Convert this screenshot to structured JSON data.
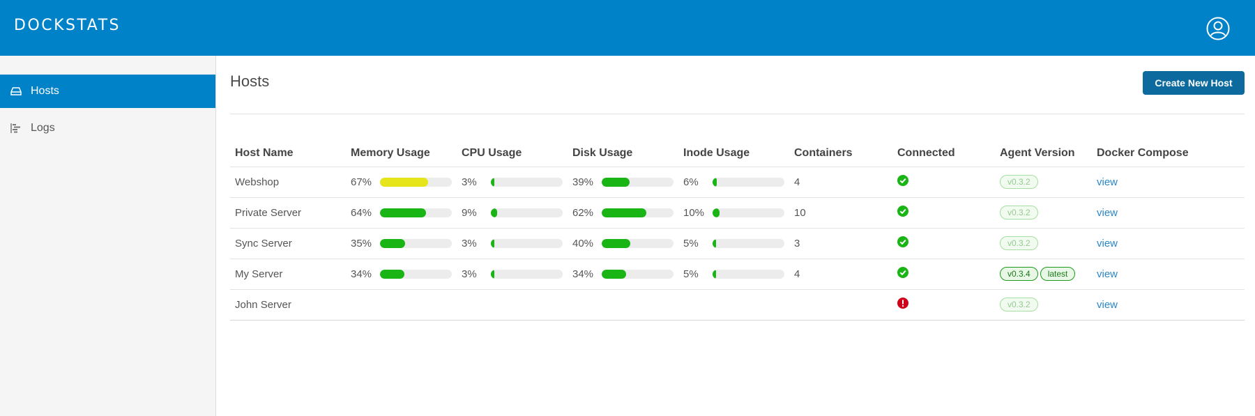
{
  "app": {
    "logo_text": "DOCKSTATS"
  },
  "sidebar": {
    "items": [
      {
        "label": "Hosts",
        "icon": "drive-icon",
        "active": true
      },
      {
        "label": "Logs",
        "icon": "logs-icon",
        "active": false
      }
    ]
  },
  "main": {
    "title": "Hosts",
    "create_button": "Create New Host"
  },
  "table": {
    "headers": [
      "Host Name",
      "Memory Usage",
      "CPU Usage",
      "Disk Usage",
      "Inode Usage",
      "Containers",
      "Connected",
      "Agent Version",
      "Docker Compose"
    ],
    "rows": [
      {
        "name": "Webshop",
        "memory": "67%",
        "memory_value": 67,
        "cpu": "3%",
        "cpu_value": 3,
        "disk": "39%",
        "disk_value": 39,
        "inode": "6%",
        "inode_value": 6,
        "containers": "4",
        "connected": true,
        "version": "v0.3.2",
        "latest": "",
        "compose": "view"
      },
      {
        "name": "Private Server",
        "memory": "64%",
        "memory_value": 64,
        "cpu": "9%",
        "cpu_value": 9,
        "disk": "62%",
        "disk_value": 62,
        "inode": "10%",
        "inode_value": 10,
        "containers": "10",
        "connected": true,
        "version": "v0.3.2",
        "latest": "",
        "compose": "view"
      },
      {
        "name": "Sync Server",
        "memory": "35%",
        "memory_value": 35,
        "cpu": "3%",
        "cpu_value": 3,
        "disk": "40%",
        "disk_value": 40,
        "inode": "5%",
        "inode_value": 5,
        "containers": "3",
        "connected": true,
        "version": "v0.3.2",
        "latest": "",
        "compose": "view"
      },
      {
        "name": "My Server",
        "memory": "34%",
        "memory_value": 34,
        "cpu": "3%",
        "cpu_value": 3,
        "disk": "34%",
        "disk_value": 34,
        "inode": "5%",
        "inode_value": 5,
        "containers": "4",
        "connected": true,
        "version": "v0.3.4",
        "latest": "latest",
        "compose": "view"
      },
      {
        "name": "John Server",
        "memory": "",
        "memory_value": null,
        "cpu": "",
        "cpu_value": null,
        "disk": "",
        "disk_value": null,
        "inode": "",
        "inode_value": null,
        "containers": "",
        "connected": false,
        "version": "v0.3.2",
        "latest": "",
        "compose": "view"
      }
    ]
  },
  "colors": {
    "primary": "#0082c8",
    "button": "#0c6a9e",
    "ok": "#19b514",
    "warn": "#e6e41a",
    "error": "#d0021b",
    "link": "#2a86c9"
  }
}
